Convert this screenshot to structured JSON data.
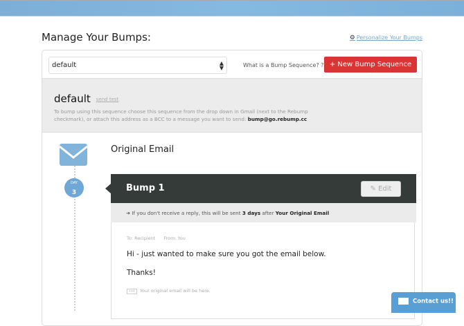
{
  "header": {
    "title": "Manage Your Bumps:",
    "personalize_link": "Personalize Your Bumps"
  },
  "toolbar": {
    "selected_sequence": "default",
    "what_is": "What is a Bump Sequence?",
    "new_button": "+ New Bump Sequence"
  },
  "sequence": {
    "name": "default",
    "send_test": "send test",
    "description": "To bump using this sequence choose this sequence from the drop down in Gmail (next to the Rebump checkmark), or attach this address as a BCC to a message you want to send:",
    "address": "bump@go.rebump.cc"
  },
  "timeline": {
    "original_label": "Original Email",
    "day_label": "DAY",
    "day_number": "3"
  },
  "bump": {
    "title": "Bump 1",
    "edit_label": "Edit",
    "info_prefix": "If you don't receive a reply, this will be sent",
    "info_days": "3 days",
    "info_mid": "after",
    "info_target": "Your Original Email",
    "to": "To: Recipient",
    "from": "From: You",
    "line1": "Hi - just wanted to make sure you got the email below.",
    "line2": "Thanks!",
    "original_note": "Your original email will be here.",
    "ellipsis": "•••"
  },
  "contact": {
    "label": "Contact us!!"
  },
  "colors": {
    "accent": "#d93535",
    "banner": "#80b1d9",
    "dark_header": "#353b39",
    "contact": "#5a9fd4"
  }
}
